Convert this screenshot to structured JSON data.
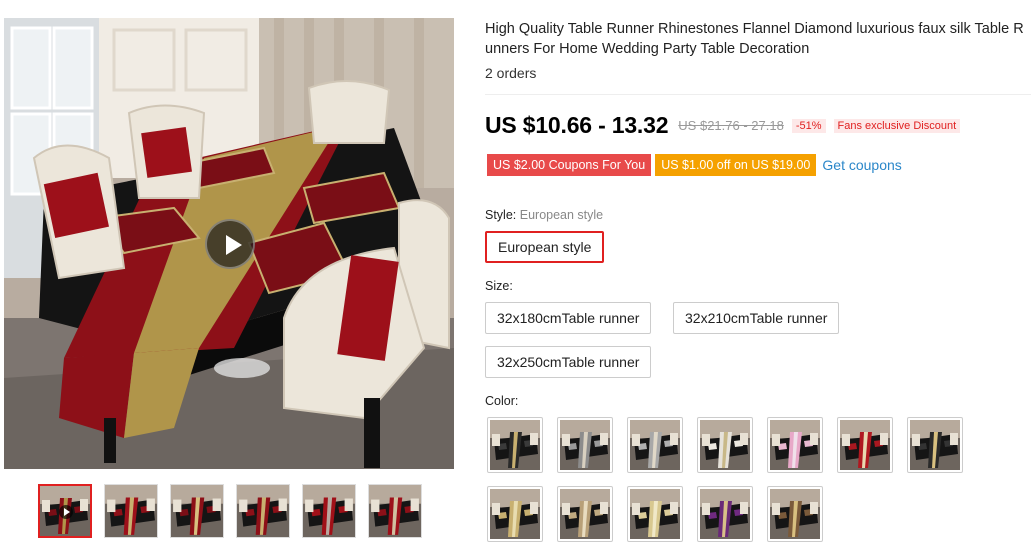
{
  "product": {
    "title": "High Quality Table Runner Rhinestones Flannel Diamond luxurious faux silk Table R unners For Home Wedding Party Table Decoration",
    "orders": "2 orders"
  },
  "price": {
    "current": "US $10.66 - 13.32",
    "original": "US $21.76 - 27.18",
    "discount": "-51%",
    "fans_discount": "Fans exclusive Discount"
  },
  "coupons": {
    "coupon1": "US $2.00 Coupons For You",
    "coupon2": "US $1.00 off on US $19.00",
    "get_coupons": "Get coupons",
    "coupon1_color": "#e84a4a",
    "coupon2_color": "#f5a100"
  },
  "style": {
    "label": "Style:",
    "selected_value": "European style",
    "options": [
      "European style"
    ]
  },
  "size": {
    "label": "Size:",
    "options": [
      "32x180cmTable runner",
      "32x210cmTable runner",
      "32x250cmTable runner"
    ]
  },
  "color": {
    "label": "Color:",
    "swatches": [
      {
        "runner": "#2a2a2a",
        "stripe": "#c8b070",
        "placemat": "#3a3a3a"
      },
      {
        "runner": "#8c8c8c",
        "stripe": "#d8d0c0",
        "placemat": "#9a9a9a"
      },
      {
        "runner": "#a8a8a8",
        "stripe": "#e0d8c8",
        "placemat": "#b0b0b0"
      },
      {
        "runner": "#e6e2da",
        "stripe": "#c8b888",
        "placemat": "#ece8e0"
      },
      {
        "runner": "#e8a8c8",
        "stripe": "#f0e0ea",
        "placemat": "#e8b8d0"
      },
      {
        "runner": "#b01820",
        "stripe": "#e8d8b0",
        "placemat": "#a81820"
      },
      {
        "runner": "#2a2a2a",
        "stripe": "#d8c080",
        "placemat": "#333333"
      },
      {
        "runner": "#c8b070",
        "stripe": "#e8dcb0",
        "placemat": "#c8b070"
      },
      {
        "runner": "#b8a078",
        "stripe": "#e8dcc0",
        "placemat": "#c0aa80"
      },
      {
        "runner": "#d8c890",
        "stripe": "#f0e8c8",
        "placemat": "#dccc98"
      },
      {
        "runner": "#6a2a78",
        "stripe": "#d8c088",
        "placemat": "#702a80"
      },
      {
        "runner": "#7a5a3a",
        "stripe": "#d8c080",
        "placemat": "#7a5a3a"
      }
    ]
  },
  "gallery": {
    "thumb_count": 6,
    "accent": "#e02020"
  }
}
